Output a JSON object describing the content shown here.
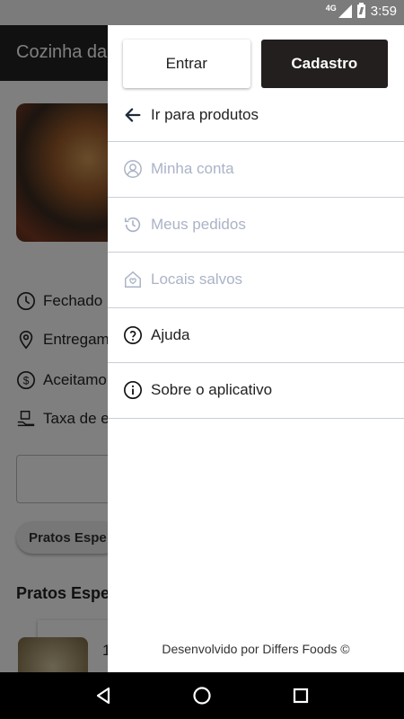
{
  "status_bar": {
    "network": "4G",
    "time": "3:59"
  },
  "background": {
    "title": "Cozinha da",
    "info": [
      "Fechado",
      "Entregam",
      "Aceitamo",
      "Taxa de e"
    ],
    "chip": "Pratos Espe",
    "section_title": "Pratos Espe",
    "card_number": "1"
  },
  "drawer": {
    "login_label": "Entrar",
    "signup_label": "Cadastro",
    "back_label": "Ir para produtos",
    "items": [
      {
        "label": "Minha conta",
        "icon": "user-circle-icon",
        "enabled": false
      },
      {
        "label": "Meus pedidos",
        "icon": "history-icon",
        "enabled": false
      },
      {
        "label": "Locais salvos",
        "icon": "saved-home-icon",
        "enabled": false
      },
      {
        "label": "Ajuda",
        "icon": "help-icon",
        "enabled": true
      },
      {
        "label": "Sobre o aplicativo",
        "icon": "info-icon",
        "enabled": true
      }
    ],
    "footer": "Desenvolvido por Differs Foods ©"
  },
  "colors": {
    "dark_button": "#231f1e",
    "disabled_text": "#aab3c6",
    "divider": "#c9ced9"
  }
}
